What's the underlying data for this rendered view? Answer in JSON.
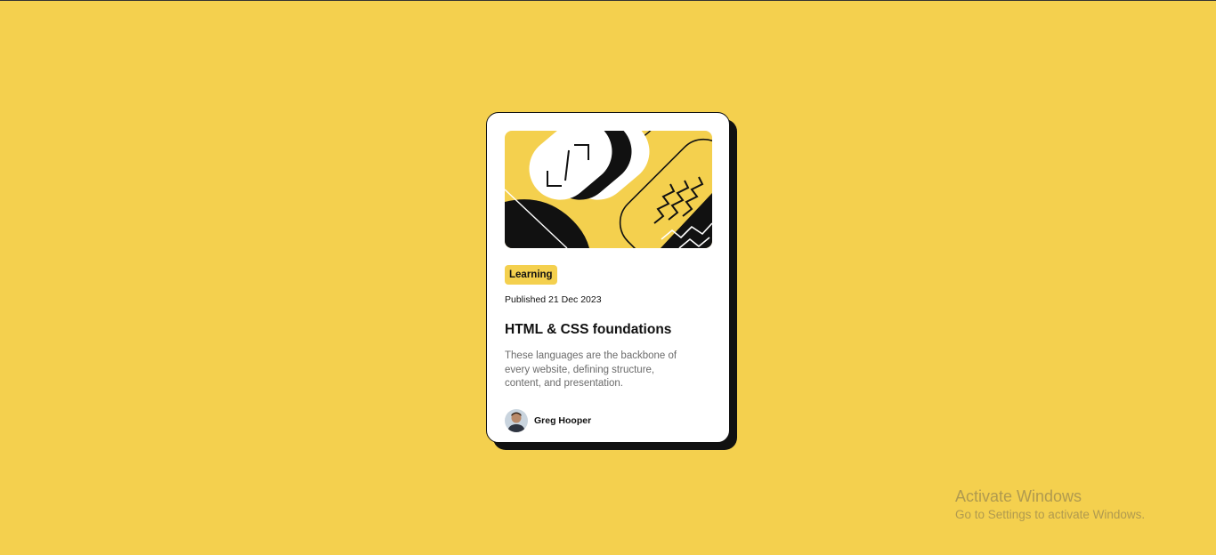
{
  "card": {
    "tag": "Learning",
    "published": "Published 21 Dec 2023",
    "title": "HTML & CSS foundations",
    "description": "These languages are the backbone of every website, defining structure, content, and presentation.",
    "author": {
      "name": "Greg Hooper",
      "avatar_icon": "avatar-photo"
    },
    "hero_image": "illustration-article"
  },
  "watermark": {
    "title": "Activate Windows",
    "subtitle": "Go to Settings to activate Windows."
  },
  "colors": {
    "background": "#f4d04e",
    "card": "#ffffff",
    "ink": "#111111",
    "muted": "#6b6b6b",
    "tag": "#f4d04e"
  }
}
